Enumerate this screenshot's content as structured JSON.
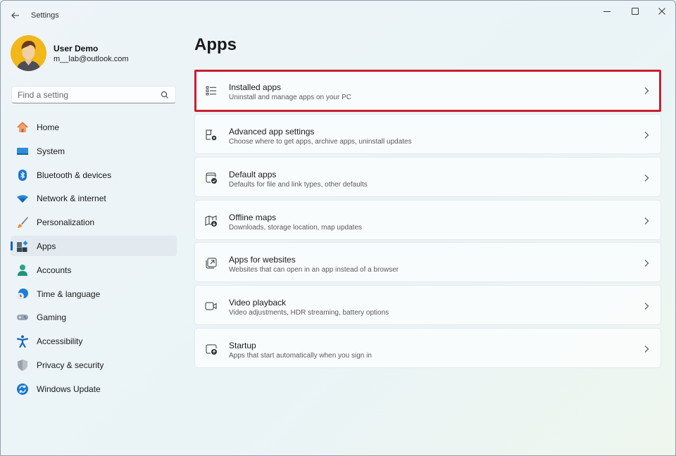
{
  "window": {
    "title": "Settings",
    "controls": {
      "minimize": "minimize",
      "maximize": "maximize",
      "close": "close"
    }
  },
  "profile": {
    "name": "User Demo",
    "email": "m__lab@outlook.com"
  },
  "search": {
    "placeholder": "Find a setting",
    "value": ""
  },
  "sidebar": {
    "items": [
      {
        "label": "Home",
        "icon": "home-icon"
      },
      {
        "label": "System",
        "icon": "system-icon"
      },
      {
        "label": "Bluetooth & devices",
        "icon": "bluetooth-icon"
      },
      {
        "label": "Network & internet",
        "icon": "wifi-icon"
      },
      {
        "label": "Personalization",
        "icon": "brush-icon"
      },
      {
        "label": "Apps",
        "icon": "apps-icon",
        "active": true
      },
      {
        "label": "Accounts",
        "icon": "account-icon"
      },
      {
        "label": "Time & language",
        "icon": "globe-clock-icon"
      },
      {
        "label": "Gaming",
        "icon": "gamepad-icon"
      },
      {
        "label": "Accessibility",
        "icon": "accessibility-icon"
      },
      {
        "label": "Privacy & security",
        "icon": "shield-icon"
      },
      {
        "label": "Windows Update",
        "icon": "update-icon"
      }
    ]
  },
  "main": {
    "title": "Apps",
    "cards": [
      {
        "title": "Installed apps",
        "subtitle": "Uninstall and manage apps on your PC",
        "icon": "list-icon",
        "highlighted": true
      },
      {
        "title": "Advanced app settings",
        "subtitle": "Choose where to get apps, archive apps, uninstall updates",
        "icon": "app-settings-icon"
      },
      {
        "title": "Default apps",
        "subtitle": "Defaults for file and link types, other defaults",
        "icon": "default-apps-icon"
      },
      {
        "title": "Offline maps",
        "subtitle": "Downloads, storage location, map updates",
        "icon": "offline-map-icon"
      },
      {
        "title": "Apps for websites",
        "subtitle": "Websites that can open in an app instead of a browser",
        "icon": "open-external-icon"
      },
      {
        "title": "Video playback",
        "subtitle": "Video adjustments, HDR streaming, battery options",
        "icon": "video-camera-icon"
      },
      {
        "title": "Startup",
        "subtitle": "Apps that start automatically when you sign in",
        "icon": "startup-icon"
      }
    ]
  },
  "colors": {
    "accent": "#0a62c4",
    "highlight_border": "#c8202f",
    "avatar_bg": "#f2b71a"
  }
}
